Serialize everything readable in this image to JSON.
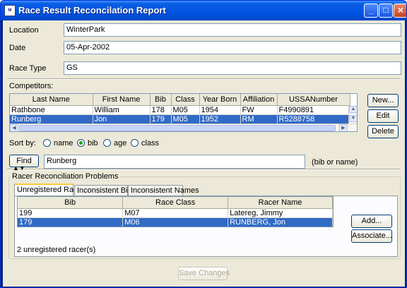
{
  "window": {
    "title": "Race Result Reconcilation Report",
    "icon_label": "ᴹ",
    "minimize_icon": "_",
    "maximize_icon": "□",
    "close_icon": "×"
  },
  "form": {
    "location_label": "Location",
    "location_value": "WinterPark",
    "date_label": "Date",
    "date_value": "05-Apr-2002",
    "race_type_label": "Race Type",
    "race_type_value": "GS",
    "competitors_label": "Competitors:"
  },
  "competitors": {
    "columns": [
      "Last Name",
      "First Name",
      "Bib",
      "Class",
      "Year Born",
      "Affiliation",
      "USSANumber"
    ],
    "rows": [
      [
        "Rathbone",
        "William",
        "178",
        "M05",
        "1954",
        "FW",
        "F4990891"
      ],
      [
        "Runberg",
        "Jon",
        "179",
        "M05",
        "1952",
        "RM",
        "R5288758"
      ]
    ],
    "selected_row": 1,
    "scroll_up_icon": "▲",
    "scroll_down_icon": "▼",
    "scroll_left_icon": "◀",
    "scroll_right_icon": "▶"
  },
  "competitor_buttons": {
    "new": "New...",
    "edit": "Edit",
    "delete": "Delete"
  },
  "sort": {
    "label": "Sort by:",
    "options": [
      "name",
      "bib",
      "age",
      "class"
    ],
    "selected": "bib"
  },
  "find": {
    "button": "Find",
    "value": "Runberg",
    "hint": "(bib or name)"
  },
  "splitter_icon": "▲▼",
  "problems": {
    "group_title": "Racer Reconciliation Problems",
    "tabs": [
      "Unregistered Racers",
      "Inconsistent Bibs",
      "Inconsistent Names"
    ],
    "active_tab": 0,
    "columns": [
      "Bib",
      "Race Class",
      "Racer Name"
    ],
    "rows": [
      [
        "199",
        "M07",
        "Latereg, Jimmy"
      ],
      [
        "179",
        "M06",
        "RUNBERG, Jon"
      ]
    ],
    "selected_row": 1,
    "add_button": "Add...",
    "associate_button": "Associate...",
    "status": "2 unregistered racer(s)"
  },
  "footer": {
    "save_button": "Save Changes"
  }
}
